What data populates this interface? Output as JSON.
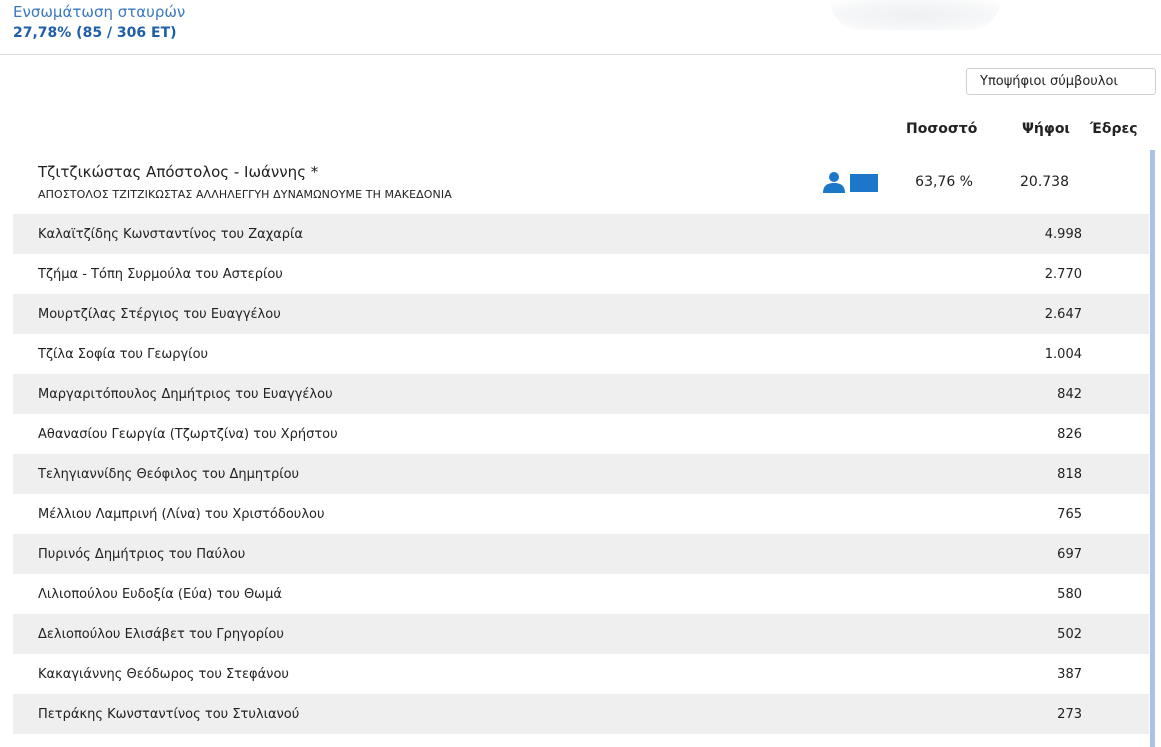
{
  "summary": {
    "title": "Ενσωμάτωση σταυρών",
    "value": "27,78% (85 / 306 ΕΤ)"
  },
  "toolbar": {
    "candidates_button_label": "Υποψήφιοι σύμβουλοι"
  },
  "table": {
    "headers": {
      "percent": "Ποσοστό",
      "votes": "Ψήφοι",
      "seats": "Έδρες"
    },
    "leader": {
      "name": "Τζιτζικώστας Απόστολος - Ιωάννης *",
      "party": "ΑΠΟΣΤΟΛΟΣ ΤΖΙΤΖΙΚΩΣΤΑΣ ΑΛΛΗΛΕΓΓΥΗ ΔΥΝΑΜΩΝΟΥΜΕ ΤΗ ΜΑΚΕΔΟΝΙΑ",
      "percent": "63,76 %",
      "votes": "20.738",
      "person_icon": "person-icon",
      "flag_icon": "flag-icon",
      "flag_color": "#1d77c9"
    },
    "rows": [
      {
        "name": "Καλαϊτζίδης Κωνσταντίνος του Ζαχαρία",
        "votes": "4.998"
      },
      {
        "name": "Τζήμα - Τόπη Συρμούλα του Αστερίου",
        "votes": "2.770"
      },
      {
        "name": "Μουρτζίλας Στέργιος του Ευαγγέλου",
        "votes": "2.647"
      },
      {
        "name": "Τζίλα Σοφία του Γεωργίου",
        "votes": "1.004"
      },
      {
        "name": "Μαργαριτόπουλος Δημήτριος του Ευαγγέλου",
        "votes": "842"
      },
      {
        "name": "Αθανασίου Γεωργία (Τζωρτζίνα) του Χρήστου",
        "votes": "826"
      },
      {
        "name": "Τεληγιαννίδης Θεόφιλος του Δημητρίου",
        "votes": "818"
      },
      {
        "name": "Μέλλιου Λαμπρινή (Λίνα) του Χριστόδουλου",
        "votes": "765"
      },
      {
        "name": "Πυρινός Δημήτριος του Παύλου",
        "votes": "697"
      },
      {
        "name": "Λιλιοπούλου Ευδοξία (Εύα) του Θωμά",
        "votes": "580"
      },
      {
        "name": "Δελιοπούλου Ελισάβετ του Γρηγορίου",
        "votes": "502"
      },
      {
        "name": "Κακαγιάννης Θεόδωρος του Στεφάνου",
        "votes": "387"
      },
      {
        "name": "Πετράκης Κωνσταντίνος του Στυλιανού",
        "votes": "273"
      }
    ]
  },
  "colors": {
    "accent": "#3a78c2",
    "row_alt": "#efefef",
    "scroll_accent": "#a9c1e6"
  }
}
